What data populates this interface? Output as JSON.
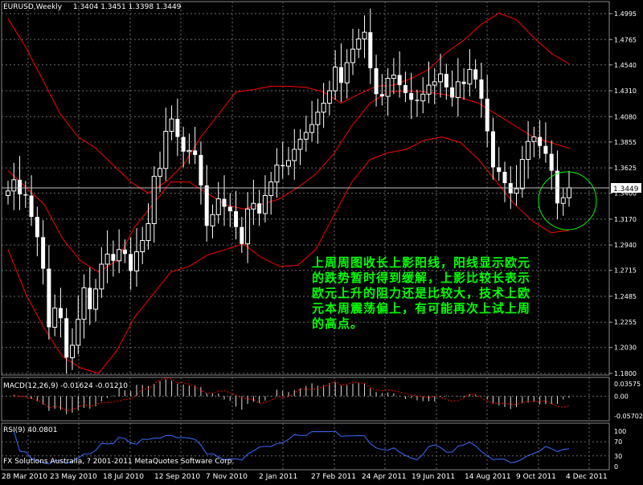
{
  "header": {
    "symbol": "EURUSD,Weekly",
    "ohlc": "1.3404 1.3451 1.3398 1.3449"
  },
  "current_price_tag": "1.3449",
  "annotation": {
    "lines": [
      "上周周图收长上影阳线，阳线显示欧元",
      "的跌势暂时得到缓解，上影比较长表示",
      "欧元上升的阻力还是比较大，技术上欧",
      "元本周震荡偏上，有可能再次上试上周",
      "的高点。"
    ]
  },
  "macd": {
    "label": "MACD(12,26,9) -0.01624 -0.01210"
  },
  "rsi": {
    "label": "RSI(9) 40.0801"
  },
  "copyright": "FX Solutions Australia, ? 2001-2011 MetaQuotes Software Corp.",
  "colors": {
    "background": "#000000",
    "grid": "#6b6b6b",
    "candle": "#ffffff",
    "bands": "#ff0000",
    "rsi_line": "#3b6bff",
    "annotation": "#00ff00",
    "circle": "#00ff00"
  },
  "chart_data": [
    {
      "type": "candlestick",
      "title": "EURUSD,Weekly",
      "y_ticks": [
        "1.4995",
        "1.4765",
        "1.4540",
        "1.4310",
        "1.4080",
        "1.3855",
        "1.3625",
        "1.3400",
        "1.3170",
        "1.2940",
        "1.2715",
        "1.2485",
        "1.2255",
        "1.2030",
        "1.1800"
      ],
      "ylim": [
        1.18,
        1.505
      ],
      "x_labels": [
        "28 Mar 2010",
        "23 May 2010",
        "18 Jul 2010",
        "12 Sep 2010",
        "7 Nov 2010",
        "2 Jan 2011",
        "27 Feb 2011",
        "24 Apr 2011",
        "19 Jun 2011",
        "14 Aug 2011",
        "9 Oct 2011",
        "4 Dec 2011"
      ],
      "close_series": [
        1.342,
        1.352,
        1.339,
        1.338,
        1.319,
        1.301,
        1.273,
        1.221,
        1.238,
        1.229,
        1.194,
        1.205,
        1.228,
        1.256,
        1.237,
        1.255,
        1.277,
        1.286,
        1.28,
        1.29,
        1.286,
        1.271,
        1.288,
        1.298,
        1.313,
        1.355,
        1.362,
        1.395,
        1.406,
        1.39,
        1.377,
        1.378,
        1.374,
        1.347,
        1.311,
        1.321,
        1.335,
        1.328,
        1.324,
        1.31,
        1.295,
        1.326,
        1.331,
        1.322,
        1.338,
        1.35,
        1.365,
        1.364,
        1.369,
        1.379,
        1.388,
        1.394,
        1.401,
        1.412,
        1.42,
        1.431,
        1.452,
        1.438,
        1.456,
        1.468,
        1.477,
        1.483,
        1.451,
        1.428,
        1.426,
        1.442,
        1.445,
        1.436,
        1.429,
        1.423,
        1.422,
        1.428,
        1.436,
        1.439,
        1.446,
        1.434,
        1.425,
        1.439,
        1.437,
        1.45,
        1.441,
        1.424,
        1.395,
        1.363,
        1.359,
        1.349,
        1.34,
        1.344,
        1.37,
        1.386,
        1.39,
        1.382,
        1.375,
        1.36,
        1.331,
        1.336,
        1.3449
      ],
      "band_upper_series": [
        1.495,
        1.47,
        1.44,
        1.41,
        1.39,
        1.38,
        1.365,
        1.35,
        1.34,
        1.35,
        1.365,
        1.39,
        1.41,
        1.43,
        1.432,
        1.435,
        1.435,
        1.434,
        1.43,
        1.42,
        1.428,
        1.435,
        1.436,
        1.442,
        1.45,
        1.465,
        1.476,
        1.49,
        1.5,
        1.494,
        1.478,
        1.464,
        1.455
      ],
      "band_middle_series": [
        1.36,
        1.345,
        1.33,
        1.3,
        1.28,
        1.27,
        1.28,
        1.31,
        1.33,
        1.35,
        1.35,
        1.34,
        1.33,
        1.326,
        1.33,
        1.335,
        1.345,
        1.357,
        1.375,
        1.4,
        1.42,
        1.43,
        1.431,
        1.43,
        1.428,
        1.425,
        1.42,
        1.41,
        1.4,
        1.39,
        1.385,
        1.38
      ],
      "band_lower_series": [
        1.29,
        1.25,
        1.22,
        1.195,
        1.185,
        1.18,
        1.2,
        1.23,
        1.25,
        1.27,
        1.275,
        1.285,
        1.29,
        1.295,
        1.283,
        1.275,
        1.276,
        1.29,
        1.32,
        1.35,
        1.37,
        1.376,
        1.379,
        1.387,
        1.39,
        1.385,
        1.37,
        1.35,
        1.33,
        1.315,
        1.305,
        1.307
      ]
    },
    {
      "type": "bar",
      "title": "MACD(12,26,9) -0.01624 -0.01210",
      "y_ticks": [
        "0.03575",
        "0.00",
        "-0.05702"
      ],
      "ylim": [
        -0.05702,
        0.03575
      ]
    },
    {
      "type": "line",
      "title": "RSI(9) 40.0801",
      "y_ticks": [
        "100",
        "70",
        "30",
        "0"
      ],
      "ylim": [
        0,
        100
      ]
    }
  ]
}
